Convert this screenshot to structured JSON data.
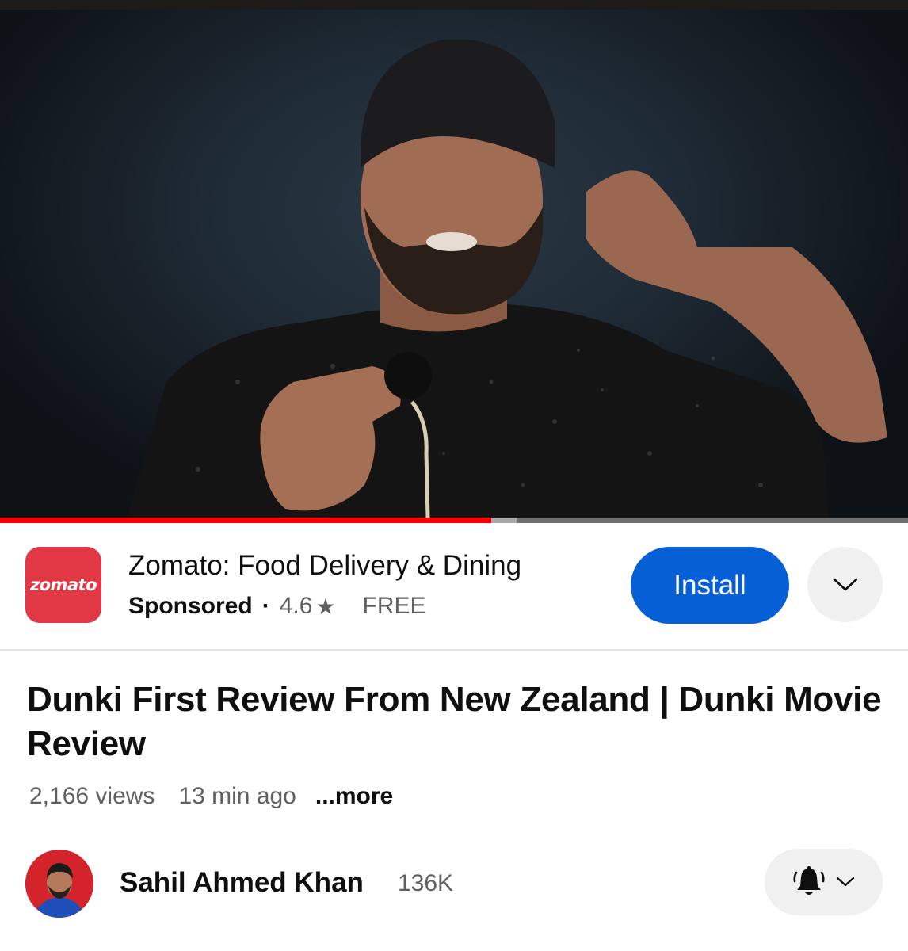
{
  "player": {
    "progress_played": 0.541,
    "progress_buffered": 0.57
  },
  "ad": {
    "logo_text": "zomato",
    "app_name": "Zomato: Food Delivery & Dining",
    "sponsored_label": "Sponsored",
    "separator": "·",
    "rating": "4.6",
    "rating_icon": "star-icon",
    "price": "FREE",
    "install_label": "Install",
    "expand_icon": "chevron-down-icon",
    "brand_color": "#e23744",
    "install_color": "#065fd4"
  },
  "video": {
    "title": "Dunki First Review From New Zealand | Dunki Movie Review",
    "views": "2,166 views",
    "age": "13 min ago",
    "more_label": "...more"
  },
  "channel": {
    "name": "Sahil Ahmed Khan",
    "subscribers": "136K",
    "notify_icon": "bell-icon",
    "notify_menu_icon": "chevron-down-icon"
  },
  "colors": {
    "progress_played": "#ff0000",
    "text_primary": "#0f0f0f",
    "text_secondary": "#606060"
  }
}
